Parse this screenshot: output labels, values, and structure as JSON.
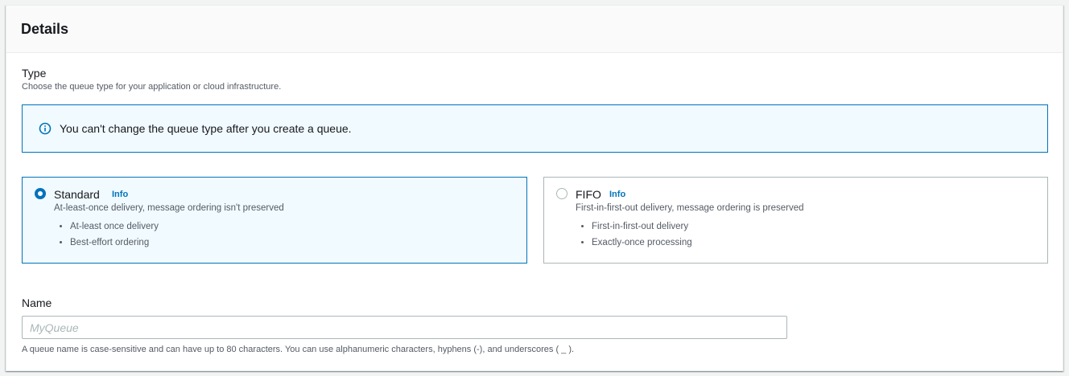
{
  "panel": {
    "title": "Details"
  },
  "type_section": {
    "label": "Type",
    "description": "Choose the queue type for your application or cloud infrastructure.",
    "alert": {
      "icon": "info-circle-icon",
      "text": "You can't change the queue type after you create a queue."
    },
    "options": [
      {
        "title": "Standard",
        "info_link": "Info",
        "selected": true,
        "description": "At-least-once delivery, message ordering isn't preserved",
        "features": [
          "At-least once delivery",
          "Best-effort ordering"
        ]
      },
      {
        "title": "FIFO",
        "info_link": "Info",
        "selected": false,
        "description": "First-in-first-out delivery, message ordering is preserved",
        "features": [
          "First-in-first-out delivery",
          "Exactly-once processing"
        ]
      }
    ]
  },
  "name_section": {
    "label": "Name",
    "value": "",
    "placeholder": "MyQueue",
    "hint": "A queue name is case-sensitive and can have up to 80 characters. You can use alphanumeric characters, hyphens (-), and underscores ( _ )."
  },
  "colors": {
    "accent": "#0073bb",
    "selected_background": "#f1faff",
    "border": "#aab7b8",
    "secondary_text": "#545b64"
  }
}
